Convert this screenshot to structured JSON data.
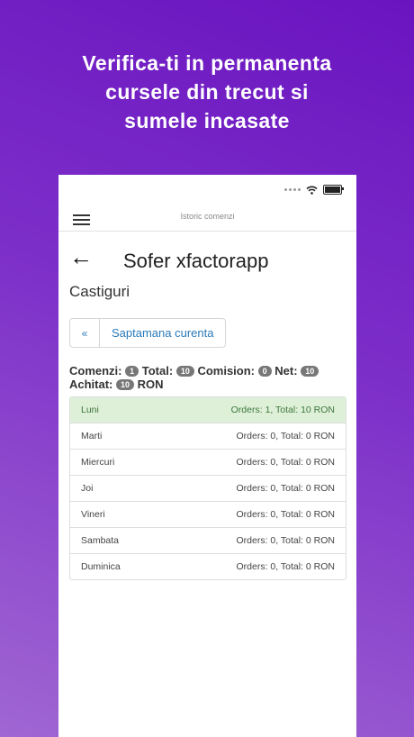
{
  "headline": "Verifica-ti in permanenta\ncursele din trecut si\nsumele incasate",
  "navbar": {
    "title": "Istoric comenzi",
    "menu_icon": "hamburger-icon"
  },
  "header": {
    "back_icon": "arrow-left-icon",
    "title": "Sofer xfactorapp"
  },
  "section": {
    "title": "Castiguri"
  },
  "week_selector": {
    "prev_label": "«",
    "current_label": "Saptamana curenta"
  },
  "summary": {
    "comenzi_label": "Comenzi:",
    "comenzi": "1",
    "total_label": "Total:",
    "total": "10",
    "comision_label": "Comision:",
    "comision": "0",
    "net_label": "Net:",
    "net": "10",
    "achitat_label": "Achitat:",
    "achitat": "10",
    "currency": "RON"
  },
  "days": [
    {
      "name": "Luni",
      "summary": "Orders: 1, Total: 10 RON"
    },
    {
      "name": "Marti",
      "summary": "Orders: 0, Total: 0 RON"
    },
    {
      "name": "Miercuri",
      "summary": "Orders: 0, Total: 0 RON"
    },
    {
      "name": "Joi",
      "summary": "Orders: 0, Total: 0 RON"
    },
    {
      "name": "Vineri",
      "summary": "Orders: 0, Total: 0 RON"
    },
    {
      "name": "Sambata",
      "summary": "Orders: 0, Total: 0 RON"
    },
    {
      "name": "Duminica",
      "summary": "Orders: 0, Total: 0 RON"
    }
  ],
  "colors": {
    "background": "#7d2fc9",
    "link": "#2a7ab8",
    "active_row": "#dff0d8",
    "active_text": "#3c763d",
    "badge": "#777777"
  }
}
